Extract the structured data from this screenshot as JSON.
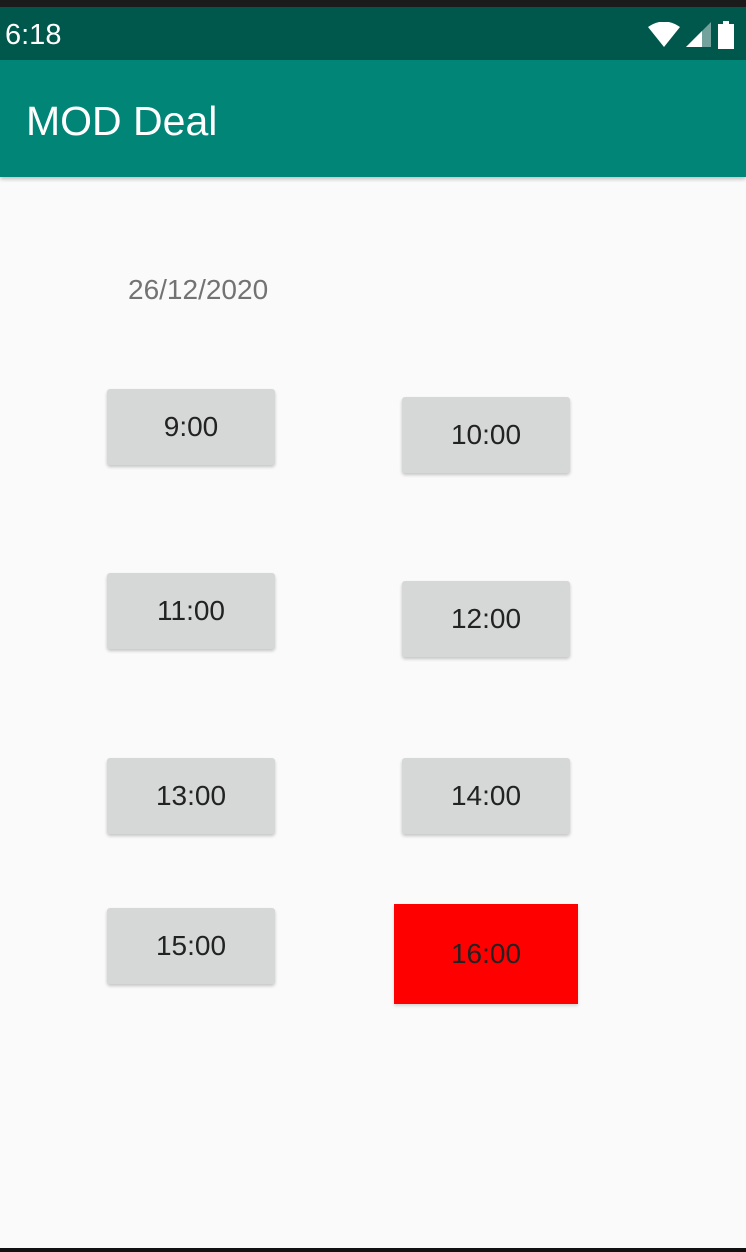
{
  "status_bar": {
    "time": "6:18",
    "icons": [
      "wifi-icon",
      "cell-signal-icon",
      "battery-icon"
    ]
  },
  "app_bar": {
    "title": "MOD Deal",
    "color": "#008577"
  },
  "date": "26/12/2020",
  "time_slots": [
    {
      "label": "9:00",
      "selected": false
    },
    {
      "label": "10:00",
      "selected": false
    },
    {
      "label": "11:00",
      "selected": false
    },
    {
      "label": "12:00",
      "selected": false
    },
    {
      "label": "13:00",
      "selected": false
    },
    {
      "label": "14:00",
      "selected": false
    },
    {
      "label": "15:00",
      "selected": false
    },
    {
      "label": "16:00",
      "selected": true
    }
  ],
  "colors": {
    "status_bar": "#00574b",
    "slot_default": "#d6d7d7",
    "slot_selected": "#ff0000"
  }
}
